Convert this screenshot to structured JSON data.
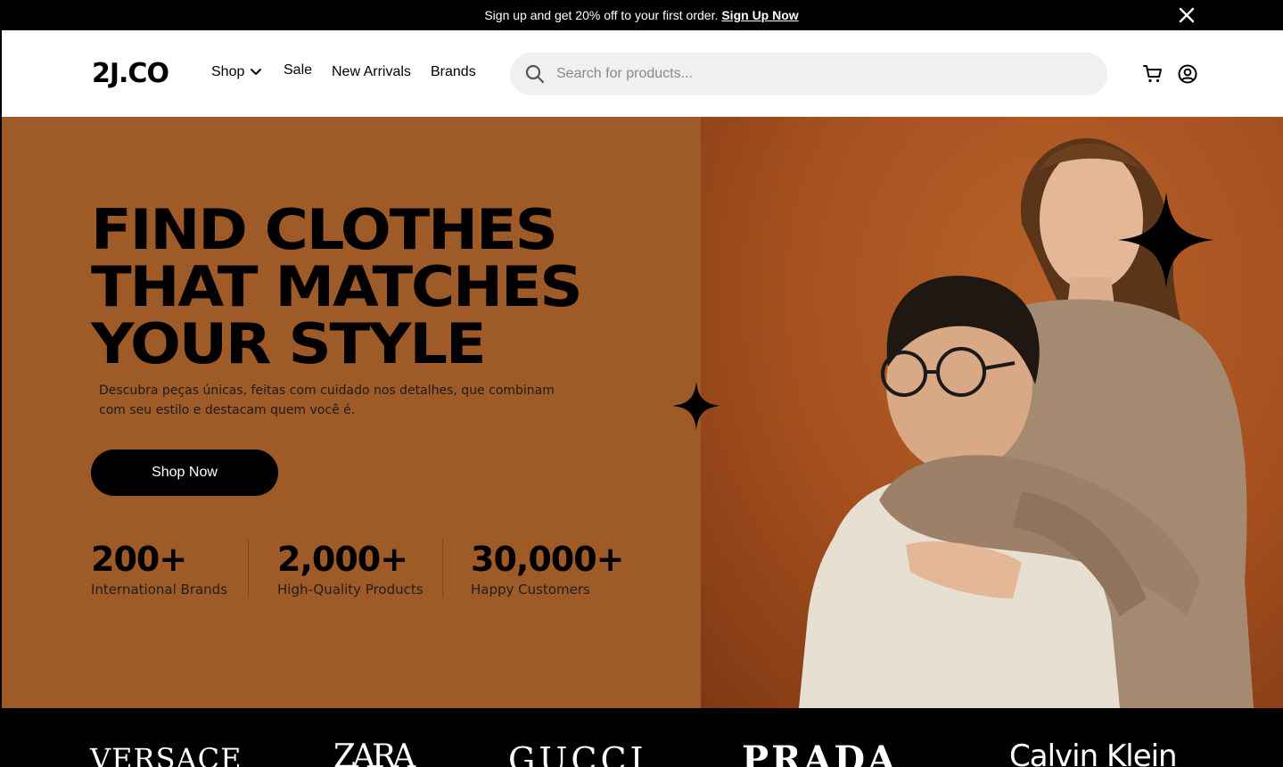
{
  "announcement": {
    "text": "Sign up and get 20% off to your first order.",
    "link_label": "Sign Up Now"
  },
  "header": {
    "logo": "2J.CO",
    "nav": {
      "shop": "Shop",
      "sale": "Sale",
      "new_arrivals": "New Arrivals",
      "brands": "Brands"
    },
    "search_placeholder": "Search for products..."
  },
  "hero": {
    "title_lines": [
      "FIND CLOTHES",
      "THAT MATCHES",
      "YOUR STYLE"
    ],
    "description": "Descubra peças únicas, feitas com cuidado nos detalhes, que combinam com seu estilo e destacam quem você é.",
    "cta_label": "Shop Now",
    "stats": [
      {
        "value": "200+",
        "label": "International Brands"
      },
      {
        "value": "2,000+",
        "label": "High-Quality Products"
      },
      {
        "value": "30,000+",
        "label": "Happy Customers"
      }
    ]
  },
  "brands": [
    "VERSACE",
    "ZARA",
    "GUCCI",
    "PRADA",
    "Calvin Klein"
  ],
  "colors": {
    "hero_bg": "#9e5a27",
    "announcement_bg": "#000000",
    "search_bg": "#f0f0f0"
  }
}
